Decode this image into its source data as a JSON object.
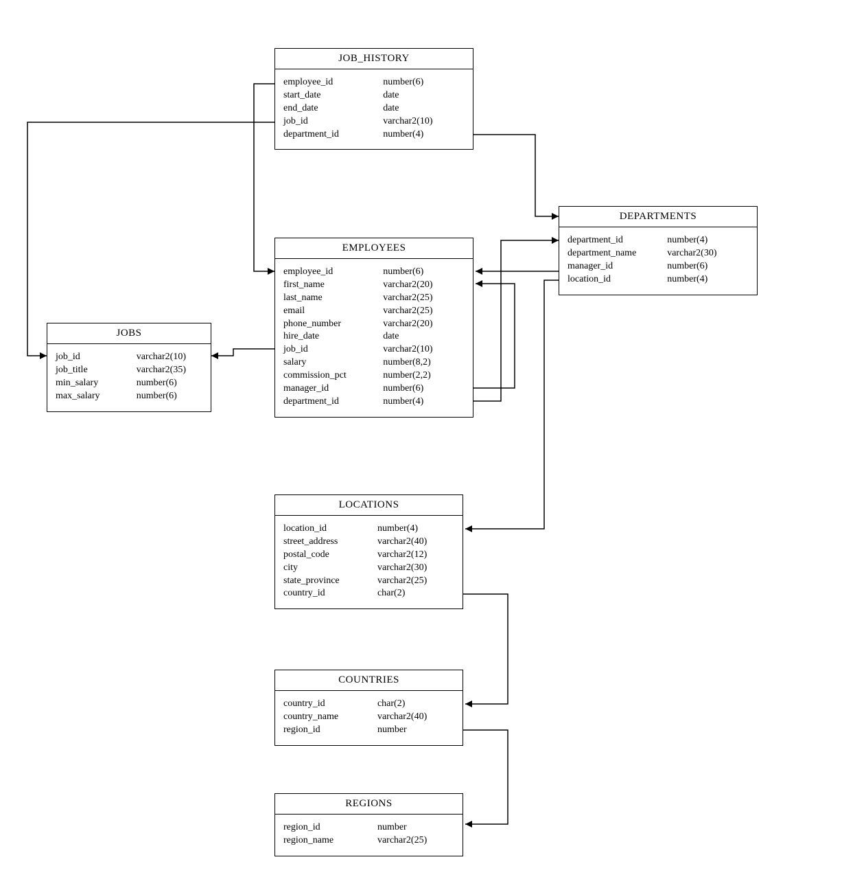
{
  "entities": {
    "job_history": {
      "title": "JOB_HISTORY",
      "columns": [
        {
          "name": "employee_id",
          "type": "number(6)"
        },
        {
          "name": "start_date",
          "type": "date"
        },
        {
          "name": "end_date",
          "type": "date"
        },
        {
          "name": "job_id",
          "type": "varchar2(10)"
        },
        {
          "name": "department_id",
          "type": "number(4)"
        }
      ]
    },
    "employees": {
      "title": "EMPLOYEES",
      "columns": [
        {
          "name": "employee_id",
          "type": "number(6)"
        },
        {
          "name": "first_name",
          "type": "varchar2(20)"
        },
        {
          "name": "last_name",
          "type": "varchar2(25)"
        },
        {
          "name": "email",
          "type": "varchar2(25)"
        },
        {
          "name": "phone_number",
          "type": "varchar2(20)"
        },
        {
          "name": "hire_date",
          "type": "date"
        },
        {
          "name": "job_id",
          "type": "varchar2(10)"
        },
        {
          "name": "salary",
          "type": "number(8,2)"
        },
        {
          "name": "commission_pct",
          "type": "number(2,2)"
        },
        {
          "name": "manager_id",
          "type": "number(6)"
        },
        {
          "name": "department_id",
          "type": "number(4)"
        }
      ]
    },
    "jobs": {
      "title": "JOBS",
      "columns": [
        {
          "name": "job_id",
          "type": "varchar2(10)"
        },
        {
          "name": "job_title",
          "type": "varchar2(35)"
        },
        {
          "name": "min_salary",
          "type": "number(6)"
        },
        {
          "name": "max_salary",
          "type": "number(6)"
        }
      ]
    },
    "departments": {
      "title": "DEPARTMENTS",
      "columns": [
        {
          "name": "department_id",
          "type": "number(4)"
        },
        {
          "name": "department_name",
          "type": "varchar2(30)"
        },
        {
          "name": "manager_id",
          "type": "number(6)"
        },
        {
          "name": "location_id",
          "type": "number(4)"
        }
      ]
    },
    "locations": {
      "title": "LOCATIONS",
      "columns": [
        {
          "name": "location_id",
          "type": "number(4)"
        },
        {
          "name": "street_address",
          "type": "varchar2(40)"
        },
        {
          "name": "postal_code",
          "type": "varchar2(12)"
        },
        {
          "name": "city",
          "type": "varchar2(30)"
        },
        {
          "name": "state_province",
          "type": "varchar2(25)"
        },
        {
          "name": "country_id",
          "type": "char(2)"
        }
      ]
    },
    "countries": {
      "title": "COUNTRIES",
      "columns": [
        {
          "name": "country_id",
          "type": "char(2)"
        },
        {
          "name": "country_name",
          "type": "varchar2(40)"
        },
        {
          "name": "region_id",
          "type": "number"
        }
      ]
    },
    "regions": {
      "title": "REGIONS",
      "columns": [
        {
          "name": "region_id",
          "type": "number"
        },
        {
          "name": "region_name",
          "type": "varchar2(25)"
        }
      ]
    }
  },
  "relationships": [
    {
      "from": "job_history.employee_id",
      "to": "employees.employee_id"
    },
    {
      "from": "job_history.job_id",
      "to": "jobs.job_id"
    },
    {
      "from": "job_history.department_id",
      "to": "departments.department_id"
    },
    {
      "from": "employees.job_id",
      "to": "jobs.job_id"
    },
    {
      "from": "employees.manager_id",
      "to": "employees.employee_id"
    },
    {
      "from": "employees.department_id",
      "to": "departments.department_id"
    },
    {
      "from": "departments.manager_id",
      "to": "employees.employee_id"
    },
    {
      "from": "departments.location_id",
      "to": "locations.location_id"
    },
    {
      "from": "locations.country_id",
      "to": "countries.country_id"
    },
    {
      "from": "countries.region_id",
      "to": "regions.region_id"
    }
  ]
}
